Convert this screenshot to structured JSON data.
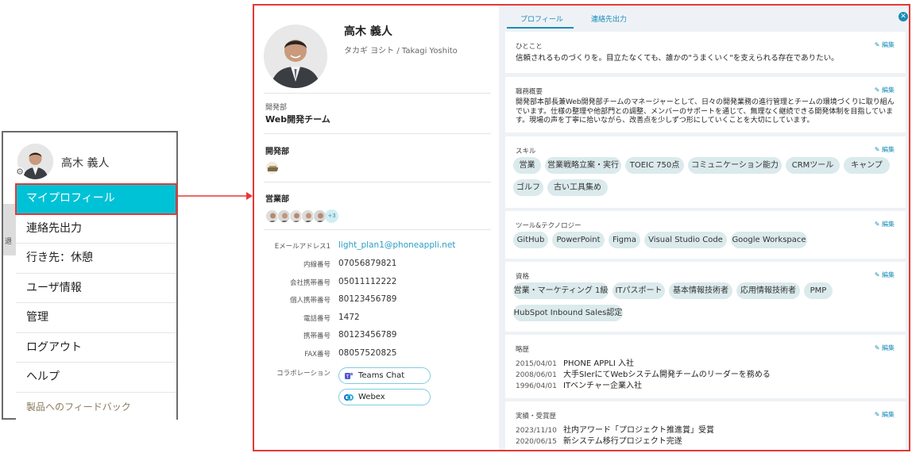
{
  "menu": {
    "user_name": "高木 義人",
    "side_fragment": "退",
    "items": [
      {
        "label": "マイプロフィール"
      },
      {
        "label": "連絡先出力"
      },
      {
        "label": "行き先：休憩"
      },
      {
        "label": "ユーザ情報"
      },
      {
        "label": "管理"
      },
      {
        "label": "ログアウト"
      },
      {
        "label": "ヘルプ"
      }
    ],
    "feedback": "製品へのフィードバック",
    "active_color": "#00c2d6"
  },
  "profile": {
    "name": "高木 義人",
    "kana": "タカギ ヨシト / Takagi Yoshito",
    "dept_label": "開発部",
    "dept_name": "Web開発チーム",
    "group1_title": "開発部",
    "group2_title": "営業部",
    "more_count": "+3",
    "fields": [
      {
        "key": "Eメールアドレス1",
        "value": "light_plan1@phoneappli.net"
      },
      {
        "key": "内線番号",
        "value": "07056879821"
      },
      {
        "key": "会社携帯番号",
        "value": "05011112222"
      },
      {
        "key": "個人携帯番号",
        "value": "80123456789"
      },
      {
        "key": "電話番号",
        "value": "1472"
      },
      {
        "key": "携帯番号",
        "value": "80123456789"
      },
      {
        "key": "FAX番号",
        "value": "08057520825"
      }
    ],
    "collab_label": "コラボレーション",
    "teams": "Teams Chat",
    "webex": "Webex",
    "link_color": "#2b9fc5"
  },
  "detail": {
    "tabs": [
      "プロフィール",
      "連絡先出力"
    ],
    "edit": "編集",
    "hitokoto_title": "ひとこと",
    "hitokoto": "信頼されるものづくりを。目立たなくても、誰かの\"うまくいく\"を支えられる存在でありたい。",
    "job_title": "職務概要",
    "job_lines": [
      "開発部本部長兼Web開発部チームのマネージャーとして、日々の開発業務の進行管理とチームの環境づくりに取り組ん",
      "でいます。仕様の整理や他部門との調整、メンバーのサポートを通じて、無理なく継続できる開発体制を目指していま",
      "す。現場の声を丁寧に拾いながら、改善点を少しずつ形にしていくことを大切にしています。"
    ],
    "skill_title": "スキル",
    "skills": [
      "営業",
      "営業戦略立案・実行",
      "TOEIC 750点",
      "コミュニケーション能力",
      "CRMツール",
      "キャンプ",
      "ゴルフ",
      "古い工具集め"
    ],
    "tools_title": "ツール&テクノロジー",
    "tools": [
      "GitHub",
      "PowerPoint",
      "Figma",
      "Visual Studio Code",
      "Google Workspace"
    ],
    "cert_title": "資格",
    "certs": [
      "営業・マーケティング 1級",
      "ITパスポート",
      "基本情報技術者",
      "応用情報技術者",
      "PMP",
      "HubSpot Inbound Sales認定"
    ],
    "history_title": "略歴",
    "history": [
      {
        "date": "2015/04/01",
        "text": "PHONE APPLI 入社"
      },
      {
        "date": "2008/06/01",
        "text": "大手SIerにてWebシステム開発チームのリーダーを務める"
      },
      {
        "date": "1996/04/01",
        "text": "ITベンチャー企業入社"
      }
    ],
    "awards_title": "実績・受賞歴",
    "awards": [
      {
        "date": "2023/11/10",
        "text": "社内アワード「プロジェクト推進賞」受賞"
      },
      {
        "date": "2020/06/15",
        "text": "新システム移行プロジェクト完遂"
      }
    ],
    "accent_color": "#1a8cb8",
    "chip_color": "#dbeaec"
  }
}
